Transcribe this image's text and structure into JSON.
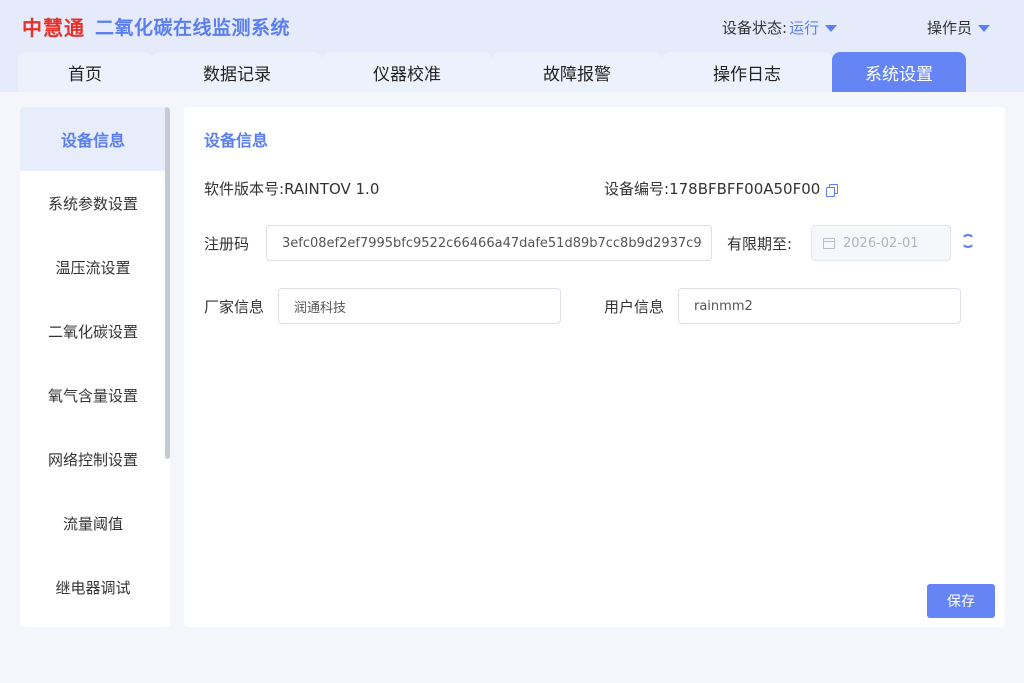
{
  "header": {
    "logo": "中慧通",
    "title": "二氧化碳在线监测系统",
    "status_label": "设备状态:",
    "status_value": "运行",
    "user_label": "操作员"
  },
  "tabs": [
    {
      "label": "首页"
    },
    {
      "label": "数据记录"
    },
    {
      "label": "仪器校准"
    },
    {
      "label": "故障报警"
    },
    {
      "label": "操作日志"
    },
    {
      "label": "系统设置",
      "active": true
    }
  ],
  "sidebar": {
    "items": [
      {
        "label": "设备信息",
        "active": true
      },
      {
        "label": "系统参数设置"
      },
      {
        "label": "温压流设置"
      },
      {
        "label": "二氧化碳设置"
      },
      {
        "label": "氧气含量设置"
      },
      {
        "label": "网络控制设置"
      },
      {
        "label": "流量阈值"
      },
      {
        "label": "继电器调试"
      }
    ]
  },
  "panel": {
    "title": "设备信息",
    "software_version_label": "软件版本号:",
    "software_version_value": "RAINTOV 1.0",
    "device_id_label": "设备编号:",
    "device_id_value": "178BFBFF00A50F00",
    "reg_code_label": "注册码",
    "reg_code_value": "3efc08ef2ef7995bfc9522c66466a47dafe51d89b7cc8b9d2937c9",
    "expiry_label": "有限期至:",
    "expiry_value": "2026-02-01",
    "vendor_label": "厂家信息",
    "vendor_value": "润通科技",
    "user_info_label": "用户信息",
    "user_info_value": "rainmm2",
    "save_label": "保存"
  },
  "colors": {
    "accent": "#6585f4",
    "brand_red": "#e8302a",
    "header_bg": "#e5ebfb"
  }
}
